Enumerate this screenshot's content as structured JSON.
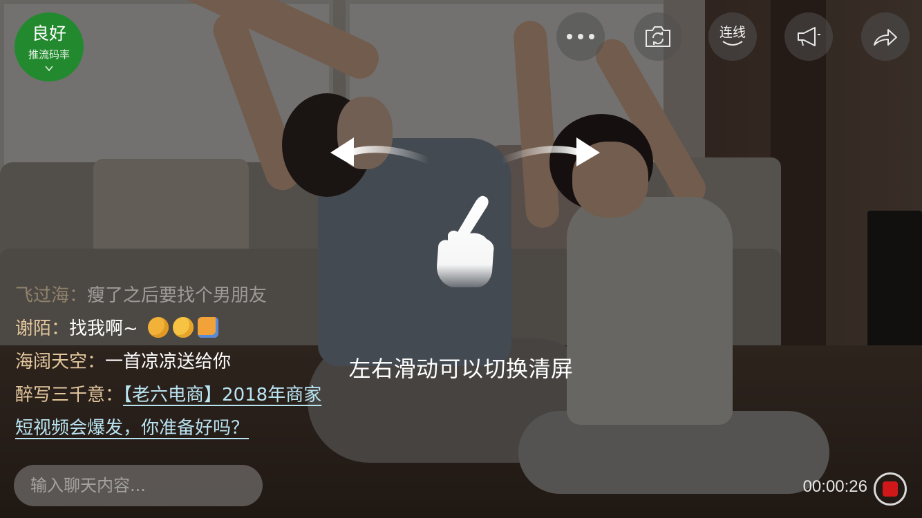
{
  "bitrate_badge": {
    "status": "良好",
    "label": "推流码率",
    "color": "#23892f",
    "icon": "chevron-down-icon"
  },
  "toolbar": {
    "items": [
      {
        "name": "more",
        "icon": "more-icon"
      },
      {
        "name": "switch_camera",
        "icon": "camera-switch-icon"
      },
      {
        "name": "link_mic",
        "icon": "link-mic-icon",
        "label": "连线"
      },
      {
        "name": "announcement",
        "icon": "megaphone-icon"
      },
      {
        "name": "share",
        "icon": "share-icon"
      }
    ]
  },
  "gesture_hint": {
    "text": "左右滑动可以切换清屏",
    "icons": [
      "swipe-left-arrow-icon",
      "swipe-right-arrow-icon",
      "hand-pointer-icon"
    ]
  },
  "chat": {
    "messages": [
      {
        "user": "飞过海",
        "separator": "：",
        "text": "瘦了之后要找个男朋友"
      },
      {
        "user": "谢陌",
        "separator": "：",
        "text": "找我啊~",
        "emojis": [
          "kiss-emoji",
          "tongue-emoji",
          "family-emoji"
        ]
      },
      {
        "user": "海阔天空",
        "separator": "：",
        "text": "一首凉凉送给你"
      },
      {
        "user": "醉写三千意",
        "separator": "：",
        "link_line1": "【老六电商】2018年商家",
        "link_line2": "短视频会爆发，你准备好吗？"
      }
    ],
    "accent_user_color": "#e4c89e",
    "link_color": "#b9e4f2"
  },
  "input": {
    "placeholder": "输入聊天内容..."
  },
  "recording": {
    "elapsed": "00:00:26",
    "record_color": "#d0181b"
  }
}
